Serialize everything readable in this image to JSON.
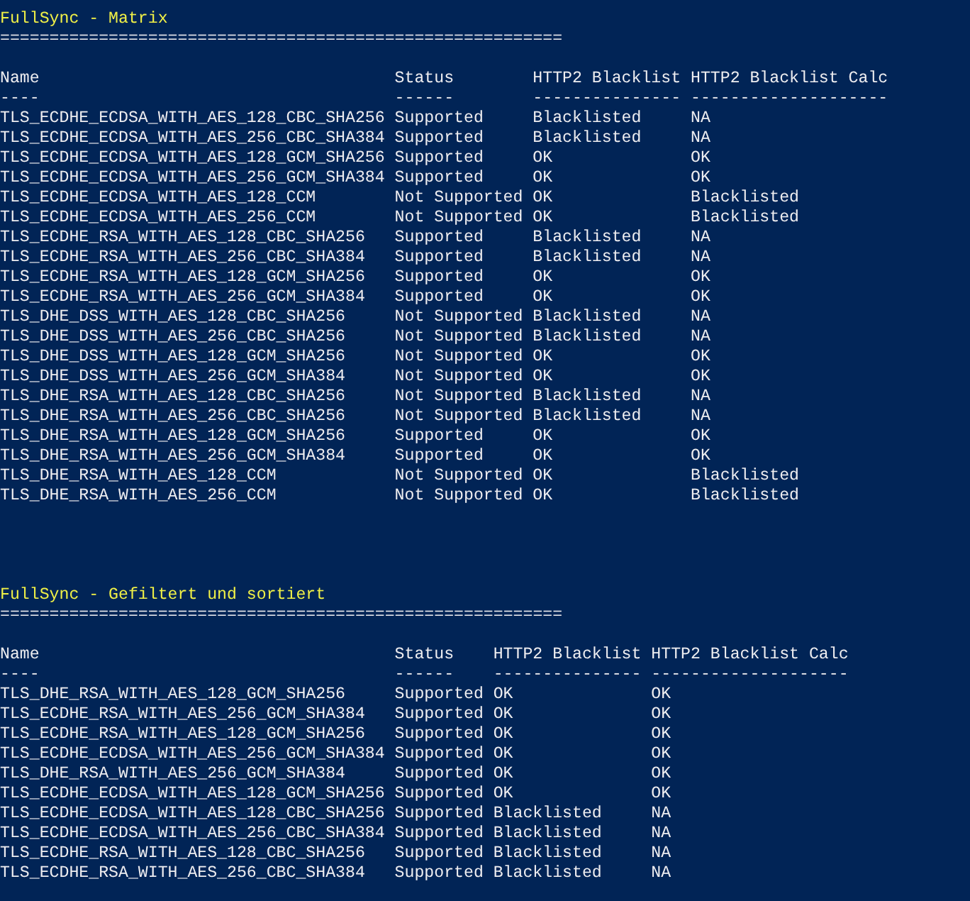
{
  "sections": [
    {
      "title": "FullSync - Matrix",
      "separator": "=========================================================",
      "columns": [
        {
          "label": "Name",
          "underline": "----"
        },
        {
          "label": "Status",
          "underline": "------"
        },
        {
          "label": "HTTP2 Blacklist",
          "underline": "---------------"
        },
        {
          "label": "HTTP2 Blacklist Calc",
          "underline": "--------------------"
        }
      ],
      "rows": [
        [
          "TLS_ECDHE_ECDSA_WITH_AES_128_CBC_SHA256",
          "Supported",
          "Blacklisted",
          "NA"
        ],
        [
          "TLS_ECDHE_ECDSA_WITH_AES_256_CBC_SHA384",
          "Supported",
          "Blacklisted",
          "NA"
        ],
        [
          "TLS_ECDHE_ECDSA_WITH_AES_128_GCM_SHA256",
          "Supported",
          "OK",
          "OK"
        ],
        [
          "TLS_ECDHE_ECDSA_WITH_AES_256_GCM_SHA384",
          "Supported",
          "OK",
          "OK"
        ],
        [
          "TLS_ECDHE_ECDSA_WITH_AES_128_CCM",
          "Not Supported",
          "OK",
          "Blacklisted"
        ],
        [
          "TLS_ECDHE_ECDSA_WITH_AES_256_CCM",
          "Not Supported",
          "OK",
          "Blacklisted"
        ],
        [
          "TLS_ECDHE_RSA_WITH_AES_128_CBC_SHA256",
          "Supported",
          "Blacklisted",
          "NA"
        ],
        [
          "TLS_ECDHE_RSA_WITH_AES_256_CBC_SHA384",
          "Supported",
          "Blacklisted",
          "NA"
        ],
        [
          "TLS_ECDHE_RSA_WITH_AES_128_GCM_SHA256",
          "Supported",
          "OK",
          "OK"
        ],
        [
          "TLS_ECDHE_RSA_WITH_AES_256_GCM_SHA384",
          "Supported",
          "OK",
          "OK"
        ],
        [
          "TLS_DHE_DSS_WITH_AES_128_CBC_SHA256",
          "Not Supported",
          "Blacklisted",
          "NA"
        ],
        [
          "TLS_DHE_DSS_WITH_AES_256_CBC_SHA256",
          "Not Supported",
          "Blacklisted",
          "NA"
        ],
        [
          "TLS_DHE_DSS_WITH_AES_128_GCM_SHA256",
          "Not Supported",
          "OK",
          "OK"
        ],
        [
          "TLS_DHE_DSS_WITH_AES_256_GCM_SHA384",
          "Not Supported",
          "OK",
          "OK"
        ],
        [
          "TLS_DHE_RSA_WITH_AES_128_CBC_SHA256",
          "Not Supported",
          "Blacklisted",
          "NA"
        ],
        [
          "TLS_DHE_RSA_WITH_AES_256_CBC_SHA256",
          "Not Supported",
          "Blacklisted",
          "NA"
        ],
        [
          "TLS_DHE_RSA_WITH_AES_128_GCM_SHA256",
          "Supported",
          "OK",
          "OK"
        ],
        [
          "TLS_DHE_RSA_WITH_AES_256_GCM_SHA384",
          "Supported",
          "OK",
          "OK"
        ],
        [
          "TLS_DHE_RSA_WITH_AES_128_CCM",
          "Not Supported",
          "OK",
          "Blacklisted"
        ],
        [
          "TLS_DHE_RSA_WITH_AES_256_CCM",
          "Not Supported",
          "OK",
          "Blacklisted"
        ]
      ]
    },
    {
      "title": "FullSync - Gefiltert und sortiert",
      "separator": "=========================================================",
      "columns": [
        {
          "label": "Name",
          "underline": "----"
        },
        {
          "label": "Status",
          "underline": "------"
        },
        {
          "label": "HTTP2 Blacklist",
          "underline": "---------------"
        },
        {
          "label": "HTTP2 Blacklist Calc",
          "underline": "--------------------"
        }
      ],
      "rows": [
        [
          "TLS_DHE_RSA_WITH_AES_128_GCM_SHA256",
          "Supported",
          "OK",
          "OK"
        ],
        [
          "TLS_ECDHE_RSA_WITH_AES_256_GCM_SHA384",
          "Supported",
          "OK",
          "OK"
        ],
        [
          "TLS_ECDHE_RSA_WITH_AES_128_GCM_SHA256",
          "Supported",
          "OK",
          "OK"
        ],
        [
          "TLS_ECDHE_ECDSA_WITH_AES_256_GCM_SHA384",
          "Supported",
          "OK",
          "OK"
        ],
        [
          "TLS_DHE_RSA_WITH_AES_256_GCM_SHA384",
          "Supported",
          "OK",
          "OK"
        ],
        [
          "TLS_ECDHE_ECDSA_WITH_AES_128_GCM_SHA256",
          "Supported",
          "OK",
          "OK"
        ],
        [
          "TLS_ECDHE_ECDSA_WITH_AES_128_CBC_SHA256",
          "Supported",
          "Blacklisted",
          "NA"
        ],
        [
          "TLS_ECDHE_ECDSA_WITH_AES_256_CBC_SHA384",
          "Supported",
          "Blacklisted",
          "NA"
        ],
        [
          "TLS_ECDHE_RSA_WITH_AES_128_CBC_SHA256",
          "Supported",
          "Blacklisted",
          "NA"
        ],
        [
          "TLS_ECDHE_RSA_WITH_AES_256_CBC_SHA384",
          "Supported",
          "Blacklisted",
          "NA"
        ]
      ]
    }
  ]
}
